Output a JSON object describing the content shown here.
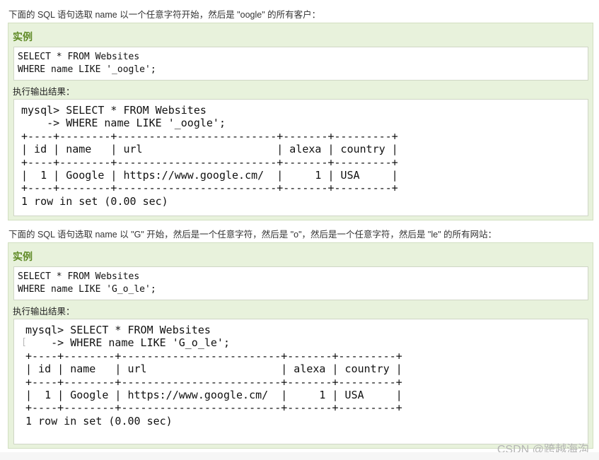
{
  "section1": {
    "intro": "下面的 SQL 语句选取 name 以一个任意字符开始，然后是 \"oogle\" 的所有客户：",
    "example_title": "实例",
    "code": "SELECT * FROM Websites\nWHERE name LIKE '_oogle';",
    "result_label": "执行输出结果：",
    "output": "mysql> SELECT * FROM Websites\n    -> WHERE name LIKE '_oogle';\n+----+--------+-------------------------+-------+---------+\n| id | name   | url                     | alexa | country |\n+----+--------+-------------------------+-------+---------+\n|  1 | Google | https://www.google.cm/  |     1 | USA     |\n+----+--------+-------------------------+-------+---------+\n1 row in set (0.00 sec)"
  },
  "section2": {
    "intro": "下面的 SQL 语句选取 name 以 \"G\" 开始，然后是一个任意字符，然后是 \"o\"，然后是一个任意字符，然后是 \"le\" 的所有网站：",
    "example_title": "实例",
    "code": "SELECT * FROM Websites\nWHERE name LIKE 'G_o_le';",
    "result_label": "执行输出结果：",
    "output": "mysql> SELECT * FROM Websites\n    -> WHERE name LIKE 'G_o_le';\n+----+--------+-------------------------+-------+---------+\n| id | name   | url                     | alexa | country |\n+----+--------+-------------------------+-------+---------+\n|  1 | Google | https://www.google.cm/  |     1 | USA     |\n+----+--------+-------------------------+-------+---------+\n1 row in set (0.00 sec)"
  },
  "watermark": "CSDN @跨越海沟"
}
